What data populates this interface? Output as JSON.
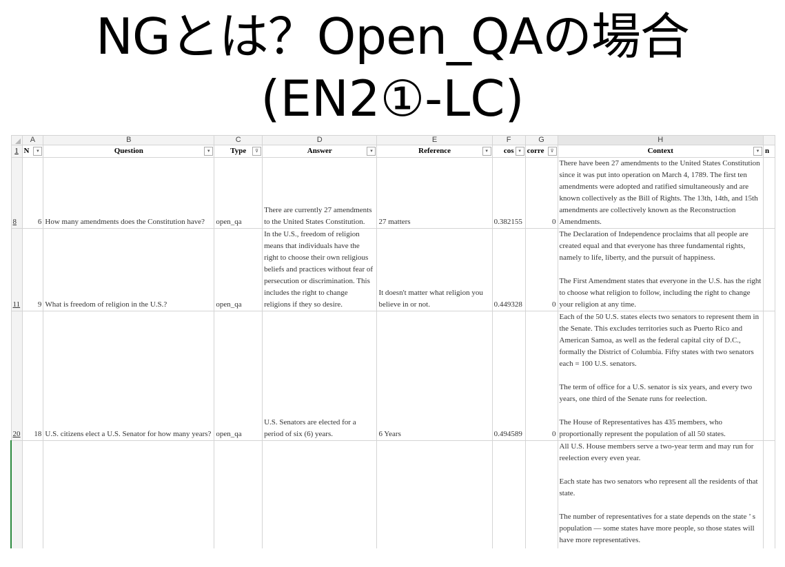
{
  "slide": {
    "title_line1": "NGとは？Open_QAの場合",
    "title_line2": "(EN2①-LC)"
  },
  "sheet": {
    "column_letters": [
      "A",
      "B",
      "C",
      "D",
      "E",
      "F",
      "G",
      "H"
    ],
    "headers": [
      "N",
      "Question",
      "Type",
      "Answer",
      "Reference",
      "cos",
      "corre",
      "Context"
    ],
    "header_overflow": "n",
    "filter_icon_plain": "▾",
    "filter_icon_active": "⊽",
    "header_row_number": "1",
    "rows": [
      {
        "row_number": "8",
        "id": "6",
        "question": "How many amendments does the Constitution have?",
        "type": "open_qa",
        "answer": " There are currently 27 amendments to the United States Constitution.",
        "reference": "27 matters",
        "cos": "0.382155",
        "correct": "0",
        "context": "There have been 27 amendments to the United States Constitution since it was put into operation on March 4, 1789. The first ten amendments were adopted and ratified simultaneously and are known collectively as the Bill of Rights. The 13th, 14th, and 15th amendments are collectively known as the Reconstruction Amendments."
      },
      {
        "row_number": "11",
        "id": "9",
        "question": "What is freedom of religion in the U.S.?",
        "type": "open_qa",
        "answer": " In the U.S., freedom of religion means that individuals have the right to choose their own religious beliefs and practices without fear of persecution or discrimination. This includes the right to change religions if they so desire.",
        "reference": "It doesn't matter what religion you believe in or not.",
        "cos": "0.449328",
        "correct": "0",
        "context_p1": "The Declaration of Independence proclaims that all people are created equal and that everyone has three fundamental rights, namely to life, liberty, and the pursuit of happiness.",
        "context_p2": "The First Amendment states that everyone in the U.S. has the right to choose what religion to follow, including the right to change your religion at any time."
      },
      {
        "row_number": "20",
        "id": "18",
        "question": "U.S. citizens elect a U.S. Senator for how many years?",
        "type": "open_qa",
        "answer": " U.S. Senators are elected for a period of six (6) years.",
        "reference": "6 Years",
        "cos": "0.494589",
        "correct": "0",
        "context_p1": "Each of the 50 U.S. states elects two senators to represent them in the Senate. This excludes territories such as Puerto Rico and American Samoa, as well as the federal capital city of D.C., formally the District of Columbia. Fifty states with two senators each = 100 U.S. senators.",
        "context_p2": "The term of office for a U.S. senator is six years, and every two years, one third of the Senate runs for reelection.",
        "context_p3": "The House of Representatives has 435 members, who proportionally represent the population of all 50 states."
      },
      {
        "row_number": "",
        "context_p1": "All U.S. House members serve a two-year term and may run for reelection every even year.",
        "context_p2": "Each state has two senators who represent all the residents of that state.",
        "context_p3": "The number of representatives for a state depends on the state ’ s population — some states have more people, so those states will have more representatives."
      }
    ]
  }
}
